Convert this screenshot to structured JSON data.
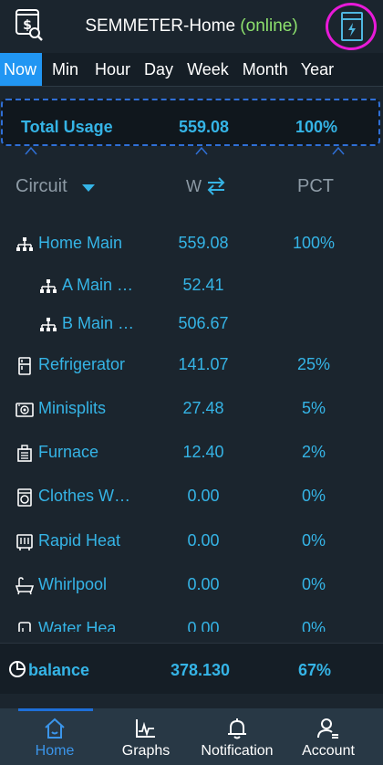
{
  "header": {
    "device_name": "SEMMETER-Home",
    "status": "(online)"
  },
  "tabs": [
    {
      "label": "Now",
      "active": true
    },
    {
      "label": "Min",
      "active": false
    },
    {
      "label": "Hour",
      "active": false
    },
    {
      "label": "Day",
      "active": false
    },
    {
      "label": "Week",
      "active": false
    },
    {
      "label": "Month",
      "active": false
    },
    {
      "label": "Year",
      "active": false
    }
  ],
  "total": {
    "label": "Total Usage",
    "value": "559.08",
    "percent": "100%"
  },
  "columns": {
    "circuit": "Circuit",
    "watts": "W",
    "percent": "PCT"
  },
  "circuits": [
    {
      "icon": "hierarchy-icon",
      "name": "Home Main",
      "value": "559.08",
      "percent": "100%"
    },
    {
      "icon": "hierarchy-icon",
      "name": "A Main …",
      "value": "52.41",
      "percent": ""
    },
    {
      "icon": "hierarchy-icon",
      "name": "B Main …",
      "value": "506.67",
      "percent": ""
    },
    {
      "icon": "refrigerator-icon",
      "name": "Refrigerator",
      "value": "141.07",
      "percent": "25%"
    },
    {
      "icon": "minisplit-icon",
      "name": "Minisplits",
      "value": "27.48",
      "percent": "5%"
    },
    {
      "icon": "furnace-icon",
      "name": "Furnace",
      "value": "12.40",
      "percent": "2%"
    },
    {
      "icon": "washer-icon",
      "name": "Clothes W…",
      "value": "0.00",
      "percent": "0%"
    },
    {
      "icon": "heater-icon",
      "name": "Rapid Heat",
      "value": "0.00",
      "percent": "0%"
    },
    {
      "icon": "bathtub-icon",
      "name": "Whirlpool",
      "value": "0.00",
      "percent": "0%"
    },
    {
      "icon": "water-heater-icon",
      "name": "Water Hea",
      "value": "0.00",
      "percent": "0%"
    }
  ],
  "balance": {
    "label": "balance",
    "value": "378.130",
    "percent": "67%"
  },
  "nav": [
    {
      "label": "Home",
      "icon": "home-icon",
      "active": true
    },
    {
      "label": "Graphs",
      "icon": "graph-icon",
      "active": false
    },
    {
      "label": "Notification",
      "icon": "bell-icon",
      "active": false
    },
    {
      "label": "Account",
      "icon": "account-icon",
      "active": false
    }
  ],
  "colors": {
    "accent_blue": "#35b4e6",
    "tab_active": "#2196f3",
    "online_green": "#8ee26e",
    "highlight_ring": "#e81ad8"
  }
}
